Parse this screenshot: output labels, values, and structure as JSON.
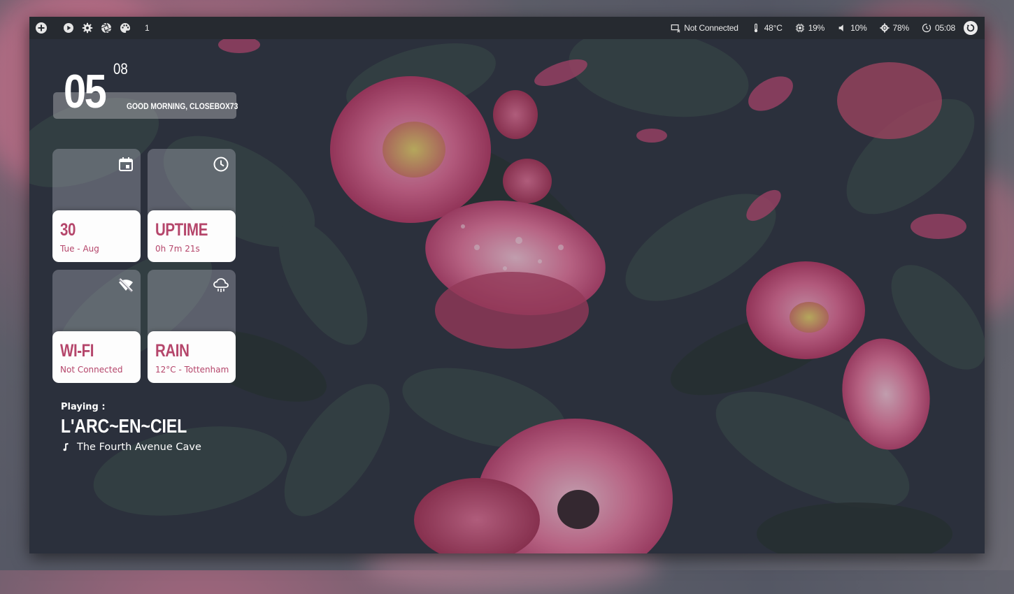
{
  "colors": {
    "accent": "#b5466b",
    "topbar": "#262a30",
    "card_bottom": "#fdfdfd",
    "text_light": "#ffffff"
  },
  "topbar": {
    "left_icons": [
      "add-icon",
      "play-icon",
      "gear-icon",
      "aperture-icon",
      "palette-icon"
    ],
    "workspace": "1",
    "network": "Not Connected",
    "temperature": "48°C",
    "cpu": "19%",
    "volume": "10%",
    "brightness": "78%",
    "time": "05:08"
  },
  "clock": {
    "hour": "05",
    "minute": "08",
    "greeting": "GOOD MORNING, CLOSEBOX73"
  },
  "cards": {
    "date": {
      "title": "30",
      "subtitle": "Tue - Aug",
      "icon": "calendar-icon"
    },
    "uptime": {
      "title": "UPTIME",
      "subtitle": "0h 7m 21s",
      "icon": "clock-icon"
    },
    "wifi": {
      "title": "WI-FI",
      "subtitle": "Not Connected",
      "icon": "wifi-off-icon"
    },
    "weather": {
      "title": "RAIN",
      "subtitle": "12°C - Tottenham",
      "icon": "rain-cloud-icon"
    }
  },
  "music": {
    "label": "Playing :",
    "artist": "L'ARC~EN~CIEL",
    "song": "The Fourth Avenue Cave",
    "icon": "music-note-icon"
  }
}
